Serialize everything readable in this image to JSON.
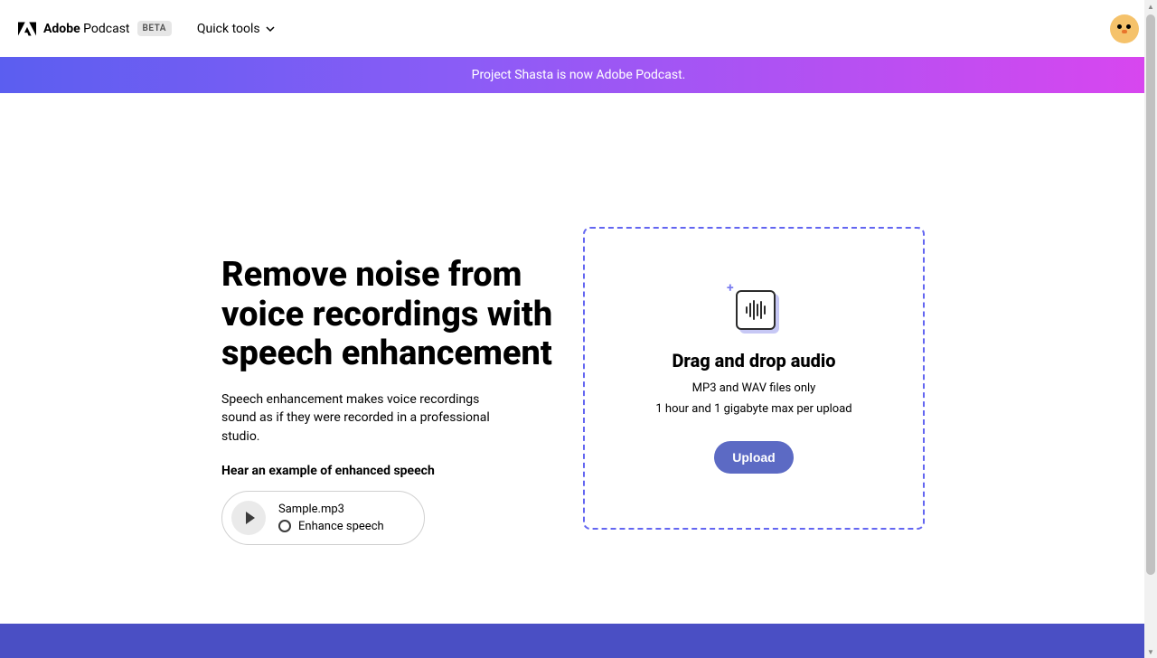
{
  "header": {
    "brand_bold": "Adobe",
    "brand_light": "Podcast",
    "beta": "BETA",
    "quick_tools": "Quick tools"
  },
  "banner": {
    "text": "Project Shasta is now Adobe Podcast."
  },
  "hero": {
    "headline": "Remove noise from voice recordings with speech enhancement",
    "subtext": "Speech enhancement makes voice recordings sound as if they were recorded in a professional studio.",
    "example_label": "Hear an example of enhanced speech",
    "sample_name": "Sample.mp3",
    "enhance_label": "Enhance speech"
  },
  "dropzone": {
    "title": "Drag and drop audio",
    "line1": "MP3 and WAV files only",
    "line2": "1 hour and 1 gigabyte max per upload",
    "upload": "Upload"
  },
  "colors": {
    "accent": "#6366f1",
    "upload_btn": "#5c6ac4",
    "banner_start": "#5b5ef0",
    "banner_end": "#d946ef",
    "footer": "#4a4fc4"
  }
}
